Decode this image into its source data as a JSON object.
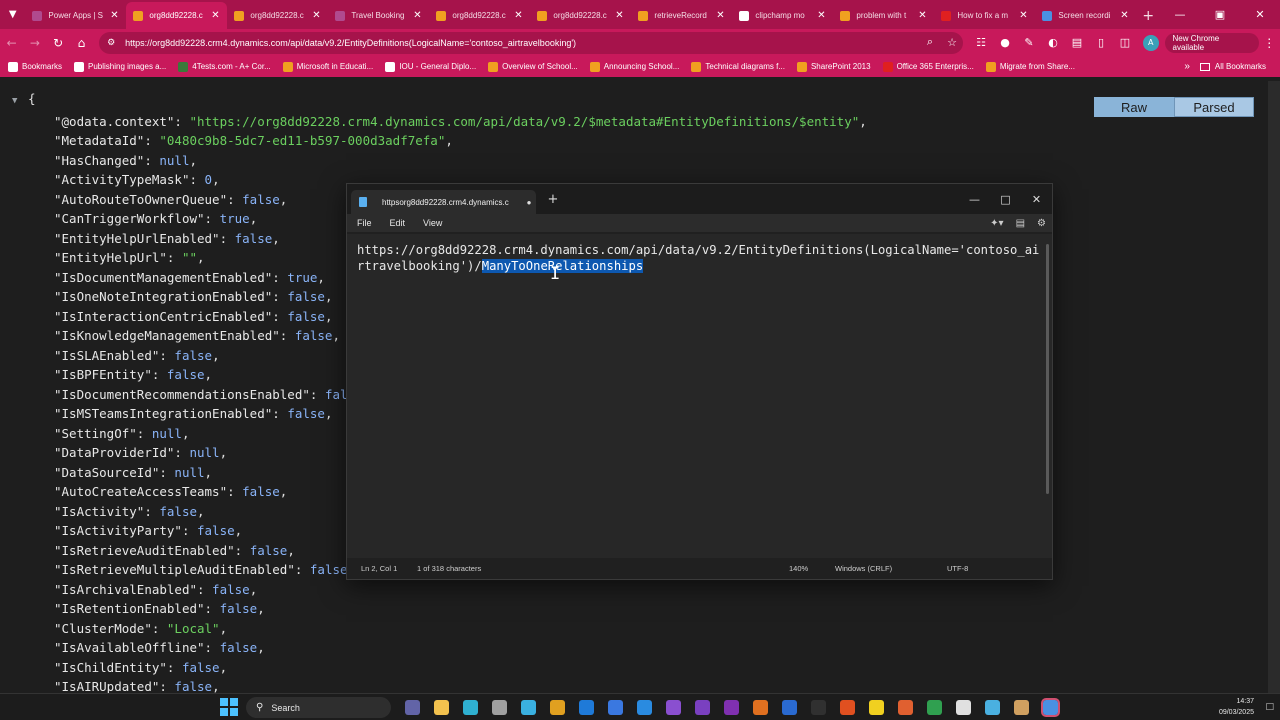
{
  "browser": {
    "tabs": [
      {
        "label": "Power Apps | S",
        "color": "#b04a8e",
        "active": false
      },
      {
        "label": "org8dd92228.c",
        "color": "#f0a020",
        "active": true
      },
      {
        "label": "org8dd92228.c",
        "color": "#f0a020",
        "active": false
      },
      {
        "label": "Travel Booking",
        "color": "#b04a8e",
        "active": false
      },
      {
        "label": "org8dd92228.c",
        "color": "#f0a020",
        "active": false
      },
      {
        "label": "org8dd92228.c",
        "color": "#f0a020",
        "active": false
      },
      {
        "label": "retrieveRecord",
        "color": "#f0a020",
        "active": false
      },
      {
        "label": "clipchamp mo",
        "color": "#ffffff",
        "active": false
      },
      {
        "label": "problem with t",
        "color": "#f0a020",
        "active": false
      },
      {
        "label": "How to fix a m",
        "color": "#e02020",
        "active": false
      },
      {
        "label": "Screen recordi",
        "color": "#4a90e2",
        "active": false
      }
    ],
    "url": "https://org8dd92228.crm4.dynamics.com/api/data/v9.2/EntityDefinitions(LogicalName='contoso_airtravelbooking')",
    "new_chrome_label": "New Chrome available",
    "avatar_letter": "A",
    "bookmarks": [
      {
        "label": "Bookmarks",
        "color": "#ffffff"
      },
      {
        "label": "Publishing images a...",
        "color": "#ffffff"
      },
      {
        "label": "4Tests.com - A+ Cor...",
        "color": "#3a7a3a"
      },
      {
        "label": "Microsoft in Educati...",
        "color": "#f0a020"
      },
      {
        "label": "IOU - General Diplo...",
        "color": "#ffffff"
      },
      {
        "label": "Overview of School...",
        "color": "#f0a020"
      },
      {
        "label": "Announcing School...",
        "color": "#f0a020"
      },
      {
        "label": "Technical diagrams f...",
        "color": "#f0a020"
      },
      {
        "label": "SharePoint 2013",
        "color": "#f0a020"
      },
      {
        "label": "Office 365 Enterpris...",
        "color": "#e02020"
      },
      {
        "label": "Migrate from Share...",
        "color": "#f0a020"
      }
    ],
    "all_bookmarks_label": "All Bookmarks"
  },
  "json_viewer": {
    "view_raw": "Raw",
    "view_parsed": "Parsed",
    "lines": [
      {
        "key": "@odata.context",
        "value": "\"https://org8dd92228.crm4.dynamics.com/api/data/v9.2/$metadata#EntityDefinitions/$entity\"",
        "type": "s"
      },
      {
        "key": "MetadataId",
        "value": "\"0480c9b8-5dc7-ed11-b597-000d3adf7efa\"",
        "type": "s"
      },
      {
        "key": "HasChanged",
        "value": "null",
        "type": "n"
      },
      {
        "key": "ActivityTypeMask",
        "value": "0",
        "type": "n"
      },
      {
        "key": "AutoRouteToOwnerQueue",
        "value": "false",
        "type": "b"
      },
      {
        "key": "CanTriggerWorkflow",
        "value": "true",
        "type": "b"
      },
      {
        "key": "EntityHelpUrlEnabled",
        "value": "false",
        "type": "b"
      },
      {
        "key": "EntityHelpUrl",
        "value": "\"\"",
        "type": "s"
      },
      {
        "key": "IsDocumentManagementEnabled",
        "value": "true",
        "type": "b"
      },
      {
        "key": "IsOneNoteIntegrationEnabled",
        "value": "false",
        "type": "b"
      },
      {
        "key": "IsInteractionCentricEnabled",
        "value": "false",
        "type": "b"
      },
      {
        "key": "IsKnowledgeManagementEnabled",
        "value": "false",
        "type": "b"
      },
      {
        "key": "IsSLAEnabled",
        "value": "false",
        "type": "b"
      },
      {
        "key": "IsBPFEntity",
        "value": "false",
        "type": "b"
      },
      {
        "key": "IsDocumentRecommendationsEnabled",
        "value": "false",
        "type": "b"
      },
      {
        "key": "IsMSTeamsIntegrationEnabled",
        "value": "false",
        "type": "b"
      },
      {
        "key": "SettingOf",
        "value": "null",
        "type": "n"
      },
      {
        "key": "DataProviderId",
        "value": "null",
        "type": "n"
      },
      {
        "key": "DataSourceId",
        "value": "null",
        "type": "n"
      },
      {
        "key": "AutoCreateAccessTeams",
        "value": "false",
        "type": "b"
      },
      {
        "key": "IsActivity",
        "value": "false",
        "type": "b"
      },
      {
        "key": "IsActivityParty",
        "value": "false",
        "type": "b"
      },
      {
        "key": "IsRetrieveAuditEnabled",
        "value": "false",
        "type": "b"
      },
      {
        "key": "IsRetrieveMultipleAuditEnabled",
        "value": "false",
        "type": "b"
      },
      {
        "key": "IsArchivalEnabled",
        "value": "false",
        "type": "b"
      },
      {
        "key": "IsRetentionEnabled",
        "value": "false",
        "type": "b"
      },
      {
        "key": "ClusterMode",
        "value": "\"Local\"",
        "type": "s"
      },
      {
        "key": "IsAvailableOffline",
        "value": "false",
        "type": "b"
      },
      {
        "key": "IsChildEntity",
        "value": "false",
        "type": "b"
      },
      {
        "key": "IsAIRUpdated",
        "value": "false",
        "type": "b"
      }
    ]
  },
  "notepad": {
    "tab_title": "httpsorg8dd92228.crm4.dynamics.c",
    "menus": [
      "File",
      "Edit",
      "View"
    ],
    "text_before": "https://org8dd92228.crm4.dynamics.com/api/data/v9.2/EntityDefinitions(LogicalName='contoso_airtravelbooking')/",
    "text_selected": "ManyToOneRelationships",
    "status": {
      "position": "Ln 2, Col 1",
      "chars": "1 of 318 characters",
      "zoom": "140%",
      "eol": "Windows (CRLF)",
      "encoding": "UTF-8"
    }
  },
  "taskbar": {
    "search_label": "Search",
    "time": "14:37",
    "date": "09/03/2025",
    "apps": [
      {
        "name": "meet-icon",
        "color": "#6264a7"
      },
      {
        "name": "file-explorer-icon",
        "color": "#f2c14e"
      },
      {
        "name": "edge-icon",
        "color": "#2fb0d0"
      },
      {
        "name": "tools-icon",
        "color": "#a0a0a0"
      },
      {
        "name": "cortana-icon",
        "color": "#3ab0e0"
      },
      {
        "name": "chrome-icon",
        "color": "#e0a020"
      },
      {
        "name": "outlook-icon",
        "color": "#1f7ad8"
      },
      {
        "name": "chat-icon",
        "color": "#3a78e0"
      },
      {
        "name": "vscode-icon",
        "color": "#2a8be0"
      },
      {
        "name": "visual-studio-icon",
        "color": "#8a4fd0"
      },
      {
        "name": "visual-studio-2-icon",
        "color": "#7a40c0"
      },
      {
        "name": "onenote-icon",
        "color": "#8030b0"
      },
      {
        "name": "office-icon",
        "color": "#e07020"
      },
      {
        "name": "badge-app-icon",
        "color": "#2a6ad0"
      },
      {
        "name": "terminal-icon",
        "color": "#303030"
      },
      {
        "name": "brave-icon",
        "color": "#e05020"
      },
      {
        "name": "sticky-notes-icon",
        "color": "#f0d020"
      },
      {
        "name": "xbox-icon",
        "color": "#e06030"
      },
      {
        "name": "chrome-2-icon",
        "color": "#30a050"
      },
      {
        "name": "media-player-icon",
        "color": "#e0e0e0"
      },
      {
        "name": "notepad-icon",
        "color": "#4ab0e0"
      },
      {
        "name": "files-icon",
        "color": "#d0a060"
      },
      {
        "name": "recorder-icon",
        "color": "#4a90e2"
      }
    ]
  }
}
